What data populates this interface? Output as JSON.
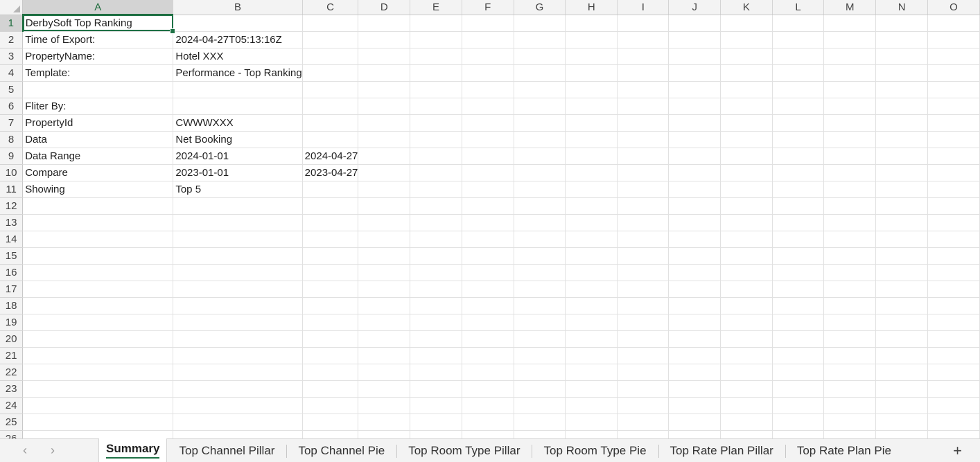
{
  "sheet": {
    "columns": [
      "A",
      "B",
      "C",
      "D",
      "E",
      "F",
      "G",
      "H",
      "I",
      "J",
      "K",
      "L",
      "M",
      "N",
      "O"
    ],
    "selected_column": "A",
    "selected_row": 1,
    "rows": [
      {
        "num": "1",
        "a": "DerbySoft Top Ranking",
        "b": "",
        "c": ""
      },
      {
        "num": "2",
        "a": "Time of Export:",
        "b": "2024-04-27T05:13:16Z",
        "c": ""
      },
      {
        "num": "3",
        "a": "PropertyName:",
        "b": "Hotel XXX",
        "c": ""
      },
      {
        "num": "4",
        "a": "Template:",
        "b": "Performance - Top Ranking",
        "c": ""
      },
      {
        "num": "5",
        "a": "",
        "b": "",
        "c": ""
      },
      {
        "num": "6",
        "a": "Fliter By:",
        "b": "",
        "c": ""
      },
      {
        "num": "7",
        "a": "PropertyId",
        "b": "CWWWXXX",
        "c": ""
      },
      {
        "num": "8",
        "a": "Data",
        "b": "Net Booking",
        "c": ""
      },
      {
        "num": "9",
        "a": "Data Range",
        "b": "2024-01-01",
        "c": "2024-04-27"
      },
      {
        "num": "10",
        "a": "Compare",
        "b": "2023-01-01",
        "c": "2023-04-27"
      },
      {
        "num": "11",
        "a": "Showing",
        "b": "Top 5",
        "c": ""
      },
      {
        "num": "12",
        "a": "",
        "b": "",
        "c": ""
      },
      {
        "num": "13",
        "a": "",
        "b": "",
        "c": ""
      },
      {
        "num": "14",
        "a": "",
        "b": "",
        "c": ""
      },
      {
        "num": "15",
        "a": "",
        "b": "",
        "c": ""
      },
      {
        "num": "16",
        "a": "",
        "b": "",
        "c": ""
      },
      {
        "num": "17",
        "a": "",
        "b": "",
        "c": ""
      },
      {
        "num": "18",
        "a": "",
        "b": "",
        "c": ""
      },
      {
        "num": "19",
        "a": "",
        "b": "",
        "c": ""
      },
      {
        "num": "20",
        "a": "",
        "b": "",
        "c": ""
      },
      {
        "num": "21",
        "a": "",
        "b": "",
        "c": ""
      },
      {
        "num": "22",
        "a": "",
        "b": "",
        "c": ""
      },
      {
        "num": "23",
        "a": "",
        "b": "",
        "c": ""
      },
      {
        "num": "24",
        "a": "",
        "b": "",
        "c": ""
      },
      {
        "num": "25",
        "a": "",
        "b": "",
        "c": ""
      },
      {
        "num": "26",
        "a": "",
        "b": "",
        "c": ""
      }
    ]
  },
  "tabbar": {
    "prev_icon": "‹",
    "next_icon": "›",
    "add_icon": "+",
    "tabs": [
      {
        "label": "Summary",
        "active": true
      },
      {
        "label": "Top Channel Pillar",
        "active": false
      },
      {
        "label": "Top Channel Pie",
        "active": false
      },
      {
        "label": "Top Room Type Pillar",
        "active": false
      },
      {
        "label": "Top Room Type Pie",
        "active": false
      },
      {
        "label": "Top Rate Plan Pillar",
        "active": false
      },
      {
        "label": "Top Rate Plan Pie",
        "active": false
      }
    ]
  },
  "colors": {
    "accent": "#1e7145",
    "header_bg": "#f3f3f3",
    "selected_header_bg": "#d3d3d3",
    "gridline": "#e1e1e1"
  }
}
